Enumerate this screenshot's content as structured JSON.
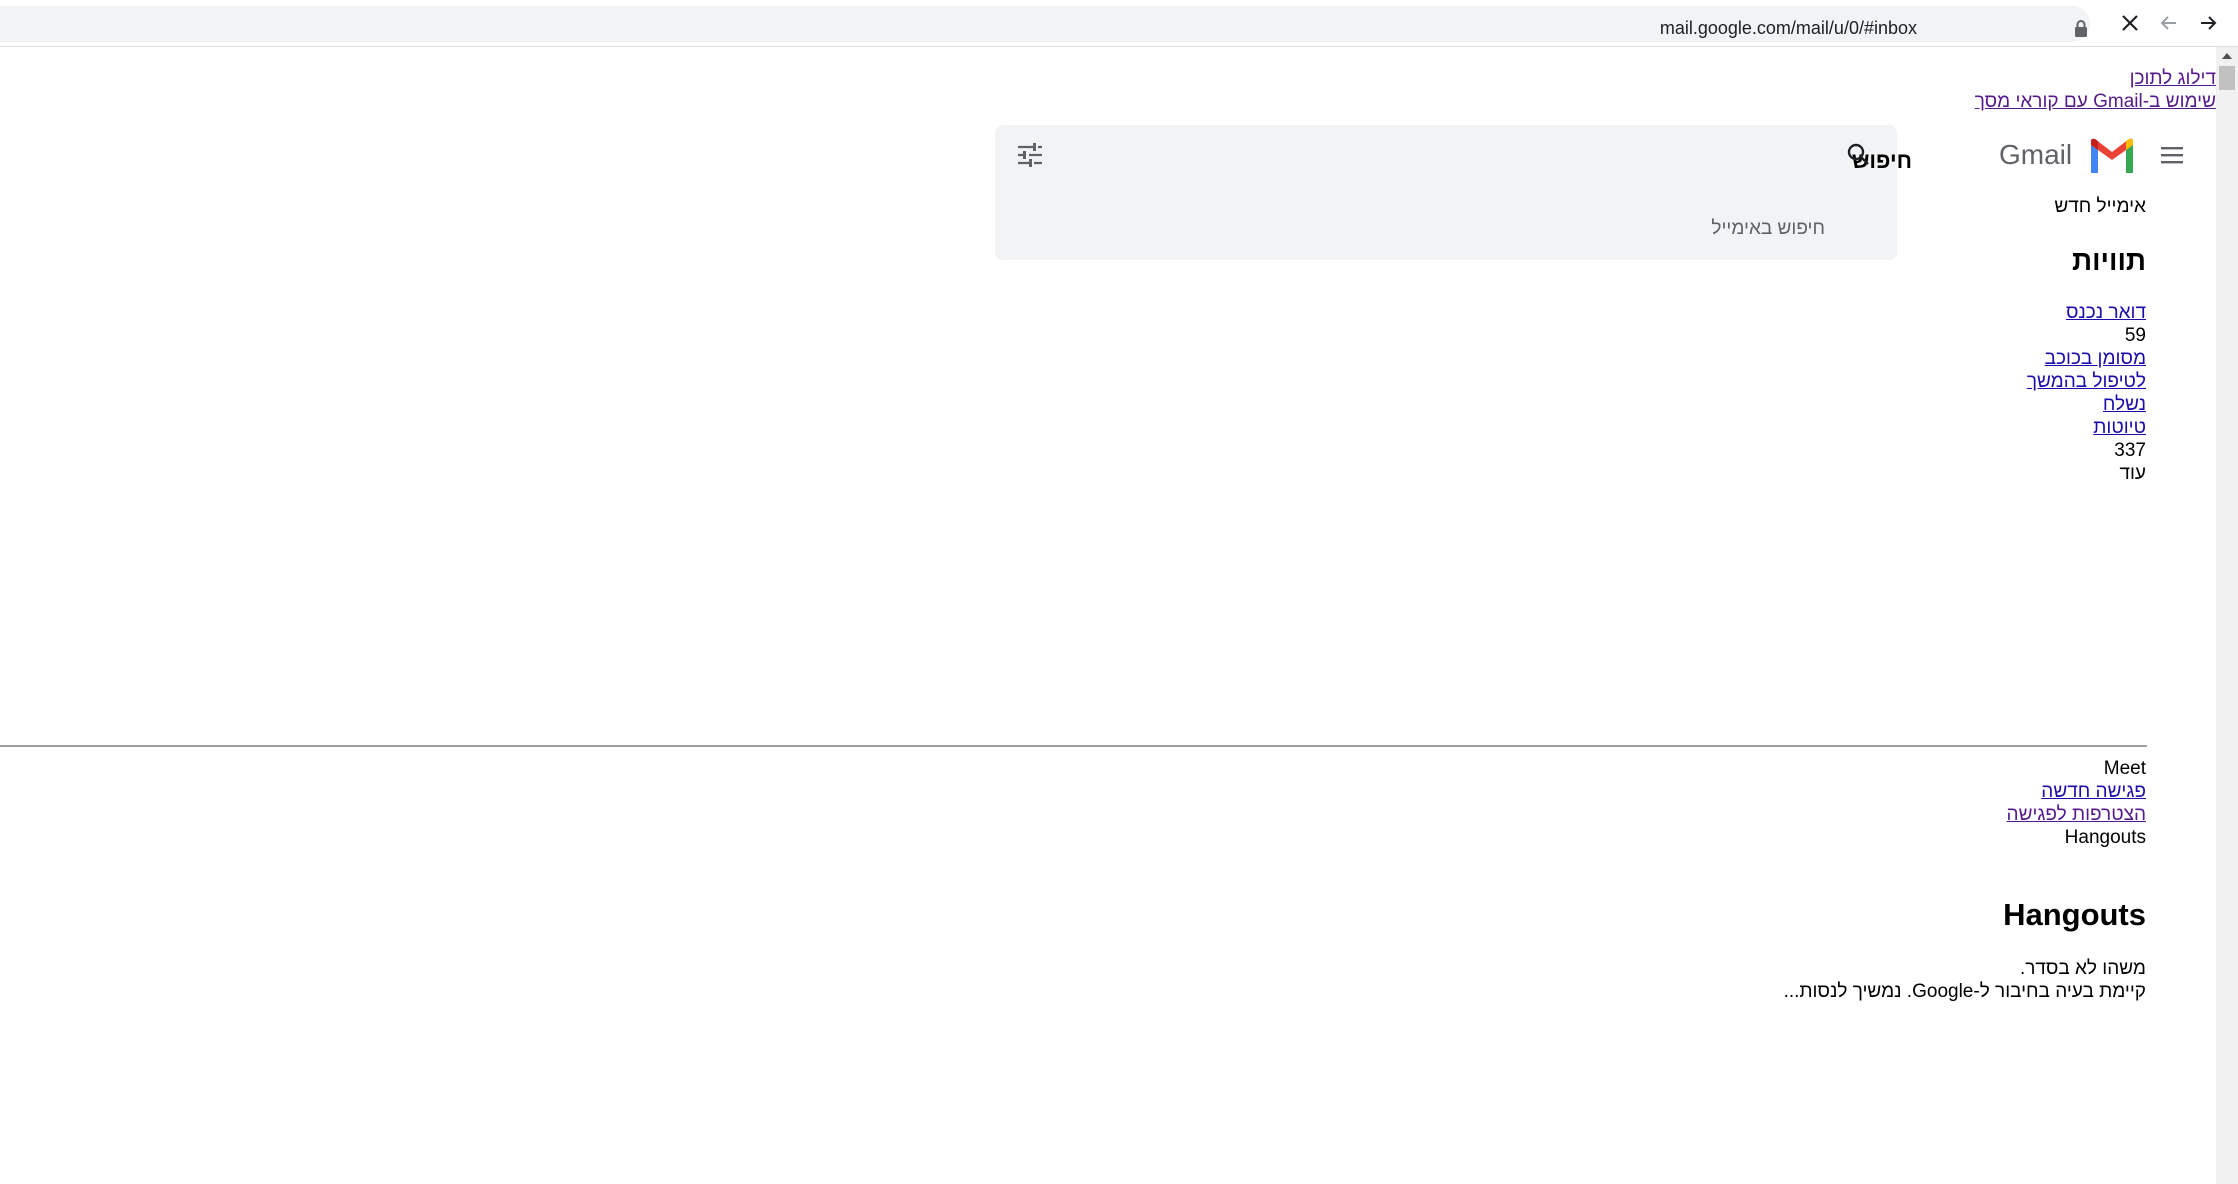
{
  "browser": {
    "url": "mail.google.com/mail/u/0/#inbox",
    "icons": [
      "lock-icon",
      "close-icon",
      "back-icon",
      "forward-icon"
    ]
  },
  "accessibility": {
    "skip_link": "דילוג לתוכן",
    "screen_reader_link": "שימוש ב-Gmail עם קוראי מסך"
  },
  "header": {
    "menu_icon": "hamburger-icon",
    "logo_icon": "gmail-logo-icon",
    "wordmark": "Gmail",
    "search_label": "חיפוש",
    "search_placeholder": "חיפוש באימייל",
    "search_options_icon": "tune-icon"
  },
  "sidebar": {
    "compose": "אימייל חדש",
    "labels_heading": "תוויות",
    "items": [
      {
        "label": "דואר נכנס",
        "count": "59"
      },
      {
        "label": "מסומן בכוכב"
      },
      {
        "label": "לטיפול בהמשך"
      },
      {
        "label": "נשלח"
      },
      {
        "label": "טיוטות",
        "count": "337"
      }
    ],
    "more": "עוד"
  },
  "meet": {
    "title": "Meet",
    "new_meeting": "פגישה חדשה",
    "join_meeting": "הצטרפות לפגישה"
  },
  "hangouts": {
    "label": "Hangouts",
    "heading": "Hangouts",
    "error_title": "משהו לא בסדר.",
    "error_message": "קיימת בעיה בחיבור ל-Google. נמשיך לנסות..."
  },
  "colors": {
    "link": "#1a0dab",
    "visited_link": "#551a8b",
    "search_bg": "#f1f3f4",
    "gmail_red": "#ea4335",
    "gmail_blue": "#4285f4",
    "gmail_green": "#34a853",
    "gmail_yellow": "#fbbc04"
  }
}
